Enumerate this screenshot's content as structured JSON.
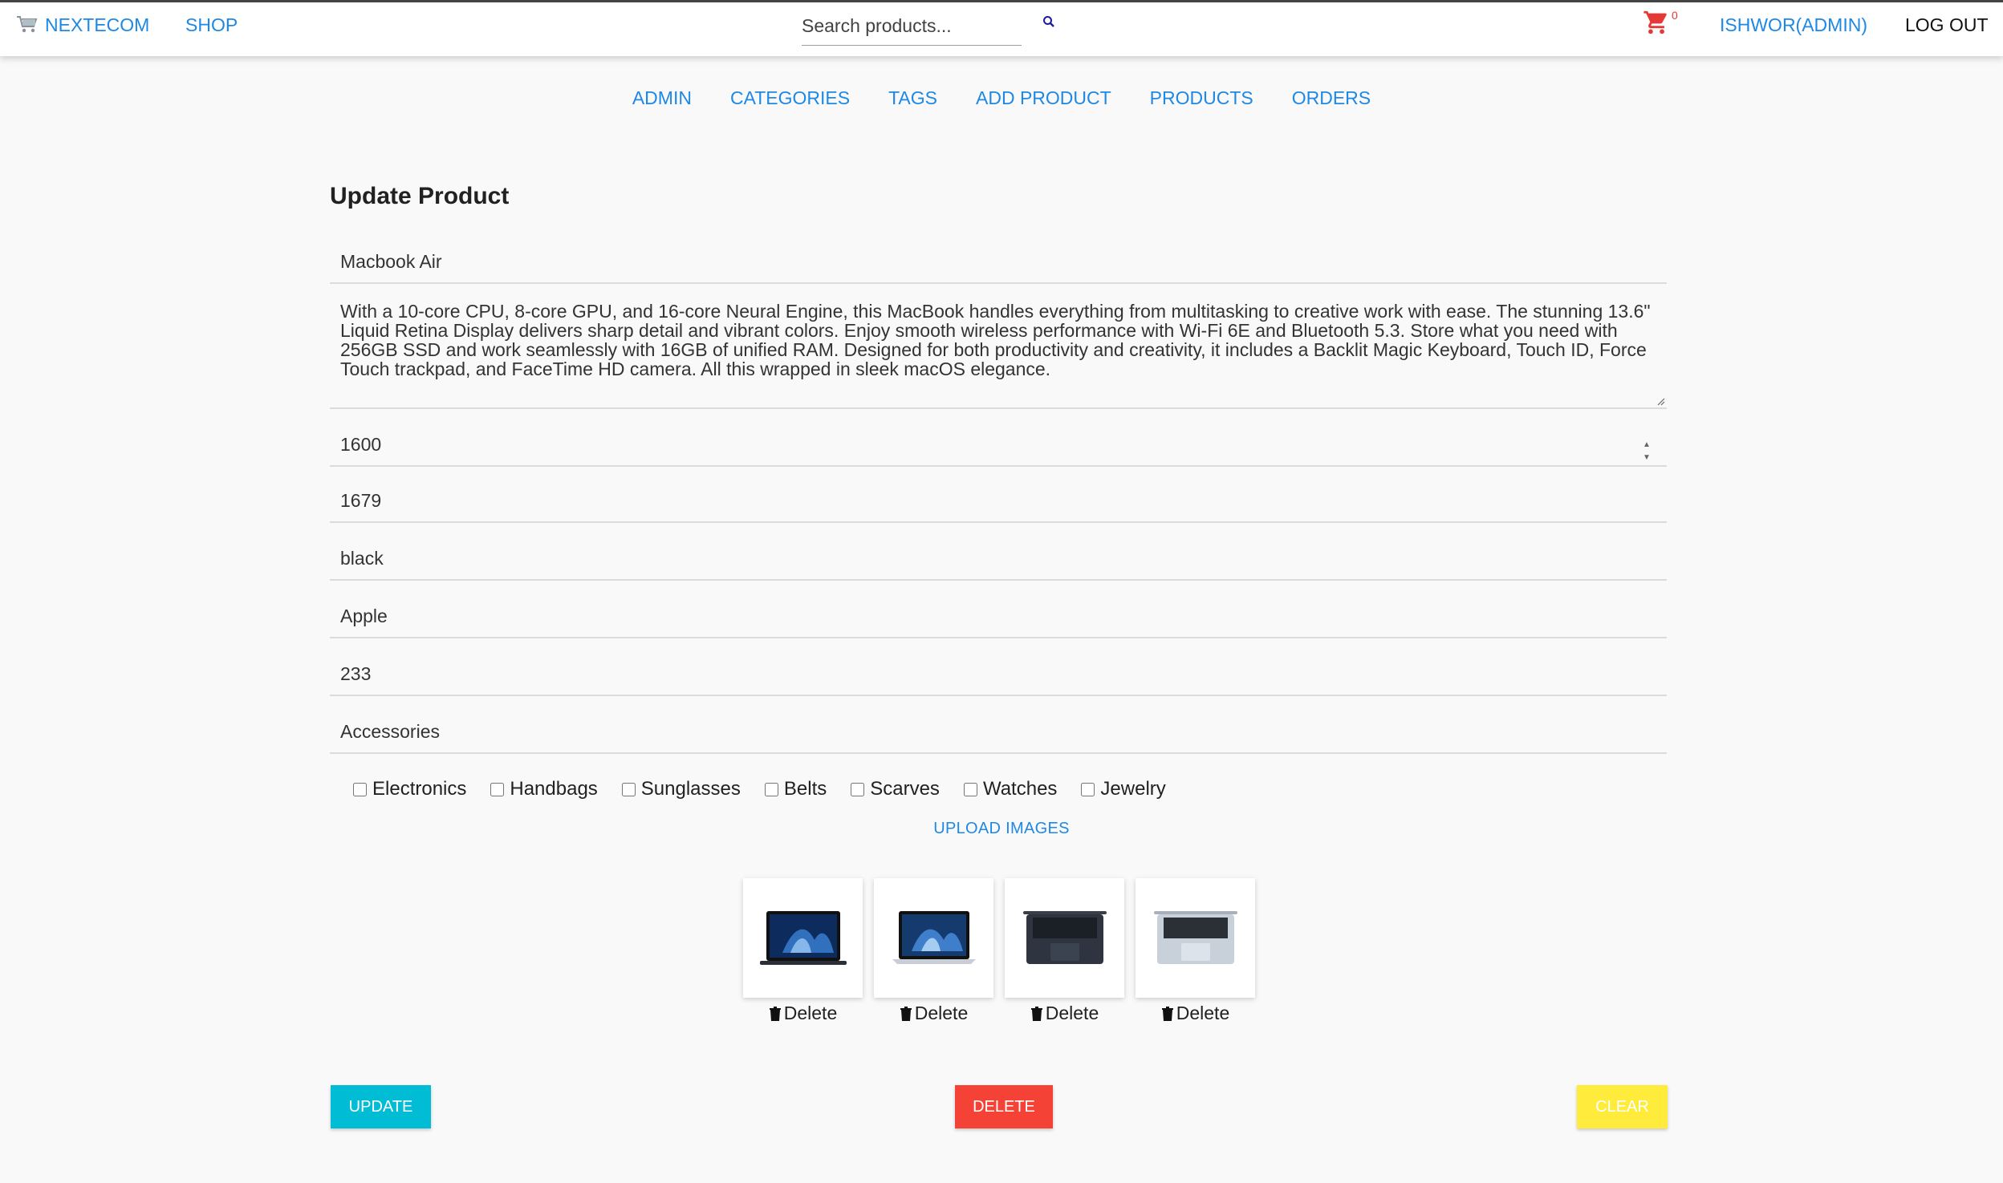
{
  "navbar": {
    "brand": "NEXTECOM",
    "shop": "SHOP",
    "search_placeholder": "Search products...",
    "cart_count": "0",
    "user": "ISHWOR(ADMIN)",
    "logout": "LOG OUT"
  },
  "admin_nav": [
    "ADMIN",
    "CATEGORIES",
    "TAGS",
    "ADD PRODUCT",
    "PRODUCTS",
    "ORDERS"
  ],
  "form": {
    "title": "Update Product",
    "name": "Macbook Air",
    "description": "With a 10-core CPU, 8-core GPU, and 16-core Neural Engine, this MacBook handles everything from multitasking to creative work with ease. The stunning 13.6\" Liquid Retina Display delivers sharp detail and vibrant colors. Enjoy smooth wireless performance with Wi-Fi 6E and Bluetooth 5.3. Store what you need with 256GB SSD and work seamlessly with 16GB of unified RAM. Designed for both productivity and creativity, it includes a Backlit Magic Keyboard, Touch ID, Force Touch trackpad, and FaceTime HD camera. All this wrapped in sleek macOS elegance.",
    "price": "1600",
    "stock": "1679",
    "color": "black",
    "brand": "Apple",
    "shipping": "233",
    "category": "Accessories"
  },
  "tags": [
    {
      "label": "Electronics",
      "checked": false
    },
    {
      "label": "Handbags",
      "checked": false
    },
    {
      "label": "Sunglasses",
      "checked": false
    },
    {
      "label": "Belts",
      "checked": false
    },
    {
      "label": "Scarves",
      "checked": false
    },
    {
      "label": "Watches",
      "checked": false
    },
    {
      "label": "Jewelry",
      "checked": false
    }
  ],
  "upload_label": "UPLOAD IMAGES",
  "images": [
    {
      "alt": "macbook-open-blue-wallpaper",
      "delete_label": "Delete"
    },
    {
      "alt": "macbook-open-blue-wallpaper-angle",
      "delete_label": "Delete"
    },
    {
      "alt": "macbook-keyboard-midnight",
      "delete_label": "Delete"
    },
    {
      "alt": "macbook-keyboard-silver",
      "delete_label": "Delete"
    }
  ],
  "buttons": {
    "update": "UPDATE",
    "delete": "DELETE",
    "clear": "CLEAR"
  },
  "colors": {
    "link_blue": "#1e88e5",
    "update": "#00bcd4",
    "delete": "#f44336",
    "clear": "#ffeb3b",
    "cart": "#e53935"
  }
}
